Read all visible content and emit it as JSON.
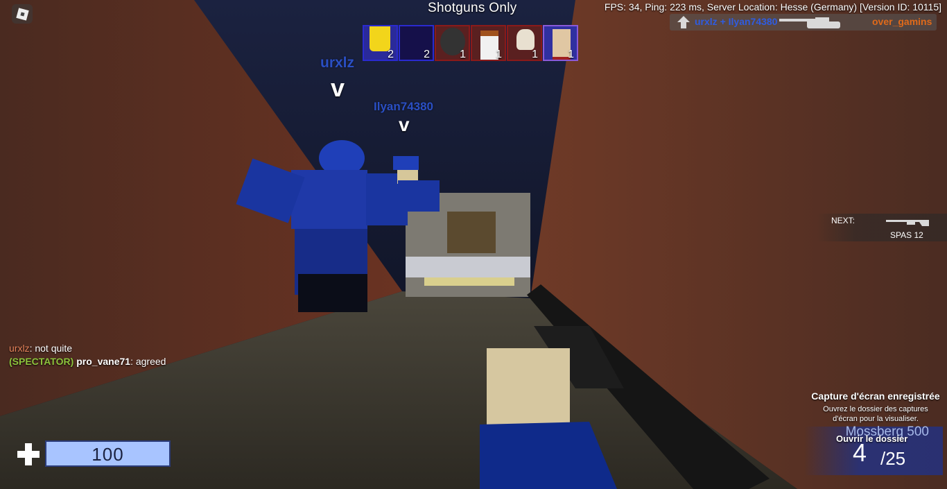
{
  "hud": {
    "mode_title": "Shotguns Only",
    "server_info": "FPS: 34, Ping: 223 ms, Server Location: Hesse (Germany)  [Version ID: 10115]",
    "killfeed": {
      "killer": "urxlz + Ilyan74380",
      "victim": "over_gamins",
      "weapon_icon": "shotgun-icon",
      "vehicle_icon": "tank-icon"
    },
    "players": [
      {
        "score": "2",
        "team": "blue",
        "avatar": "yellow-noob"
      },
      {
        "score": "2",
        "team": "blue",
        "avatar": "empty"
      },
      {
        "score": "1",
        "team": "red",
        "avatar": "helmet"
      },
      {
        "score": "1",
        "team": "red",
        "avatar": "bacon-hair"
      },
      {
        "score": "1",
        "team": "red",
        "avatar": "skull"
      },
      {
        "score": "1",
        "team": "blue",
        "avatar": "classic"
      }
    ],
    "nametags": [
      {
        "name": "urxlz",
        "arrow": "v"
      },
      {
        "name": "Ilyan74380",
        "arrow": "v"
      }
    ],
    "next_weapon": {
      "label": "NEXT:",
      "name": "SPAS 12"
    },
    "chat": [
      {
        "user": "urxlz",
        "message": ": not quite"
      },
      {
        "tag": "(SPECTATOR)",
        "user": "pro_vane71",
        "message": ": agreed"
      }
    ],
    "health": {
      "value": "100",
      "fraction": 1.0
    },
    "ammo": {
      "weapon": "Mossberg 500",
      "magazine": "4",
      "reserve": "/25"
    }
  },
  "toast": {
    "title": "Capture d'écran enregistrée",
    "body": "Ouvrez le dossier des captures d'écran pour la visualiser.",
    "action": "Ouvrir le dossier"
  },
  "colors": {
    "team_blue": "#2a4fc4",
    "team_red": "#8a1a1a",
    "health": "#a8c4ff"
  }
}
